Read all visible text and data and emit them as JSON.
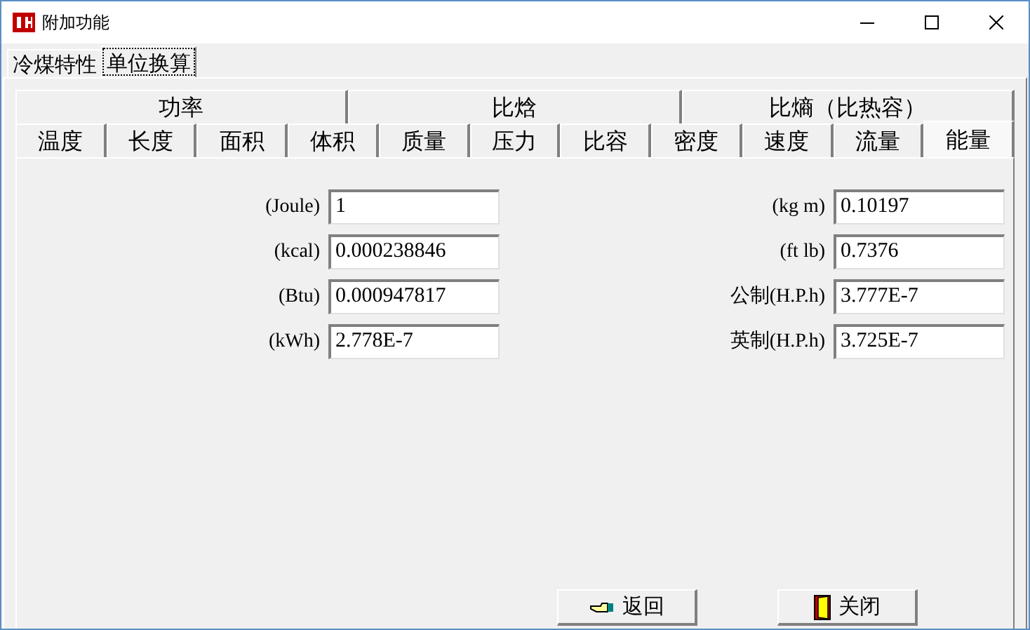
{
  "window": {
    "title": "附加功能"
  },
  "top_tabs": [
    {
      "label": "冷煤特性",
      "selected": false
    },
    {
      "label": "单位换算",
      "selected": true
    }
  ],
  "tab_rows": [
    [
      {
        "label": "功率",
        "selected": false
      },
      {
        "label": "比焓",
        "selected": false
      },
      {
        "label": "比熵（比热容）",
        "selected": false
      }
    ],
    [
      {
        "label": "温度",
        "selected": false
      },
      {
        "label": "长度",
        "selected": false
      },
      {
        "label": "面积",
        "selected": false
      },
      {
        "label": "体积",
        "selected": false
      },
      {
        "label": "质量",
        "selected": false
      },
      {
        "label": "压力",
        "selected": false
      },
      {
        "label": "比容",
        "selected": false
      },
      {
        "label": "密度",
        "selected": false
      },
      {
        "label": "速度",
        "selected": false
      },
      {
        "label": "流量",
        "selected": false
      },
      {
        "label": "能量",
        "selected": true
      }
    ]
  ],
  "fields_left": [
    {
      "label": "(Joule)",
      "value": "1"
    },
    {
      "label": "(kcal)",
      "value": "0.000238846"
    },
    {
      "label": "(Btu)",
      "value": "0.000947817"
    },
    {
      "label": "(kWh)",
      "value": "2.778E-7"
    }
  ],
  "fields_right": [
    {
      "label": "(kg m)",
      "value": "0.10197"
    },
    {
      "label": "(ft lb)",
      "value": "0.7376"
    },
    {
      "label": "公制(H.P.h)",
      "value": "3.777E-7"
    },
    {
      "label": "英制(H.P.h)",
      "value": "3.725E-7"
    }
  ],
  "buttons": [
    {
      "label": "返回",
      "kind": "back"
    },
    {
      "label": "关闭",
      "kind": "close"
    }
  ]
}
